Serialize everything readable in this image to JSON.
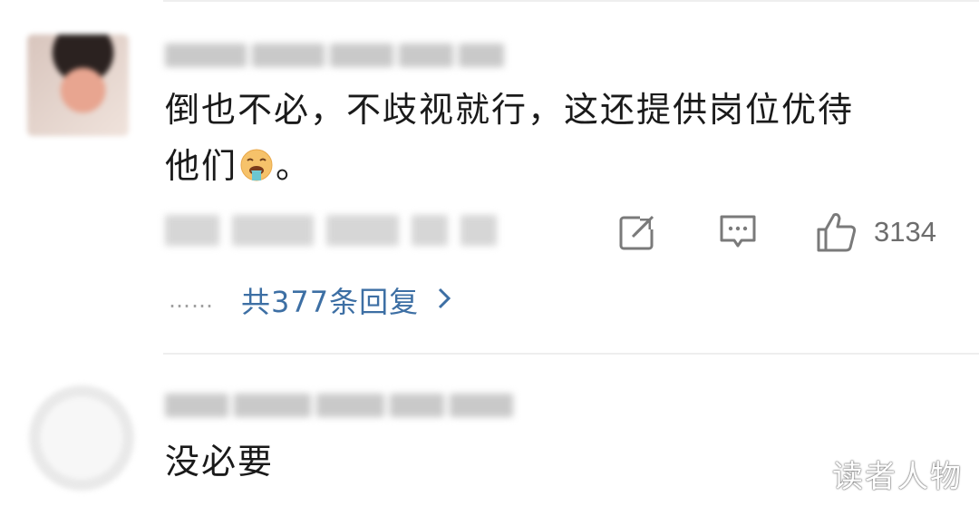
{
  "comments": [
    {
      "text_line1": "倒也不必，不歧视就行，这还提供岗位优待",
      "text_line2_before": "他们",
      "text_line2_after": "。",
      "emoji": "vomiting-face-emoji",
      "actions": {
        "share_icon": "share-icon",
        "comment_icon": "comment-icon",
        "like_icon": "thumbs-up-icon",
        "like_count": "3134"
      },
      "replies": {
        "dots": "……",
        "label": "共377条回复"
      }
    },
    {
      "text": "没必要"
    }
  ],
  "watermark": "读者人物",
  "colors": {
    "link": "#3d6fa4",
    "text": "#1a1a1a",
    "muted": "#7a7a7a",
    "divider": "#eeeeee"
  }
}
